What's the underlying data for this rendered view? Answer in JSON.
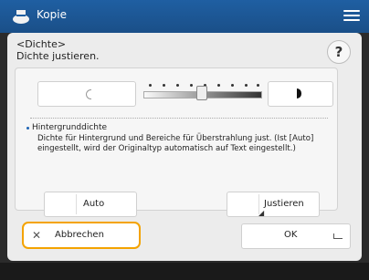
{
  "app": {
    "title": "Kopie"
  },
  "header": {
    "line1": "<Dichte>",
    "line2": "Dichte justieren."
  },
  "help": {
    "label": "?"
  },
  "density": {
    "lighter_icon": "half-circle-light-icon",
    "darker_icon": "half-circle-dark-icon",
    "level_fraction": 0.5
  },
  "background": {
    "title": "Hintergrunddichte",
    "description": "Dichte für Hintergrund und Bereiche für Überstrahlung just. (Ist [Auto] eingestellt, wird der Originaltyp automatisch auf Text eingestellt.)"
  },
  "buttons": {
    "auto": "Auto",
    "adjust": "Justieren",
    "cancel": "Abbrechen",
    "ok": "OK"
  },
  "colors": {
    "titlebar": "#1f5fa2",
    "highlight": "#f4a300"
  }
}
